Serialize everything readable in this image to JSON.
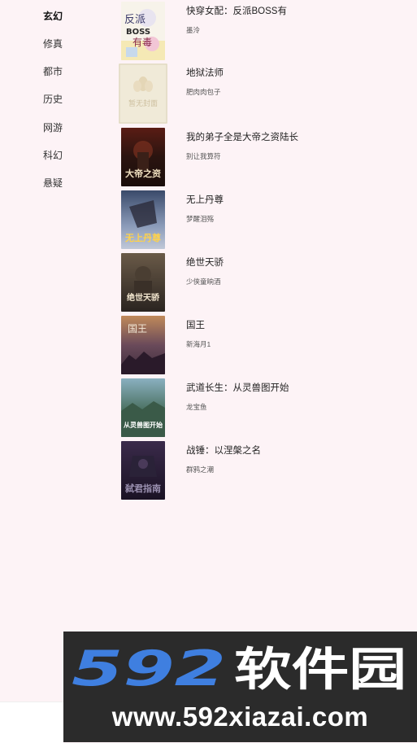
{
  "categories": [
    {
      "label": "玄幻",
      "active": true
    },
    {
      "label": "修真"
    },
    {
      "label": "都市"
    },
    {
      "label": "历史"
    },
    {
      "label": "网游"
    },
    {
      "label": "科幻"
    },
    {
      "label": "悬疑"
    }
  ],
  "books": [
    {
      "title": "快穿女配：反派BOSS有",
      "author": "墨泠",
      "cover_text": "反派BOSS有毒"
    },
    {
      "title": "地狱法师",
      "author": "肥肉肉包子",
      "cover_text": "暂无封面"
    },
    {
      "title": "我的弟子全是大帝之资陆长",
      "author": "别让我算符",
      "cover_text": "大帝之资"
    },
    {
      "title": "无上丹尊",
      "author": "梦醒泪殇",
      "cover_text": "无上丹尊"
    },
    {
      "title": "绝世天骄",
      "author": "少侠童晌酒",
      "cover_text": "绝世天骄"
    },
    {
      "title": "国王",
      "author": "新海月1",
      "cover_text": "国王"
    },
    {
      "title": "武道长生：从灵兽图开始",
      "author": "龙宝鱼",
      "cover_text": "从灵兽图开始"
    },
    {
      "title": "战锤：以涅槃之名",
      "author": "群鸦之潮",
      "cover_text": "弑君指南"
    }
  ],
  "watermark": {
    "logo": "592软件园",
    "url": "www.592xiazai.com"
  }
}
